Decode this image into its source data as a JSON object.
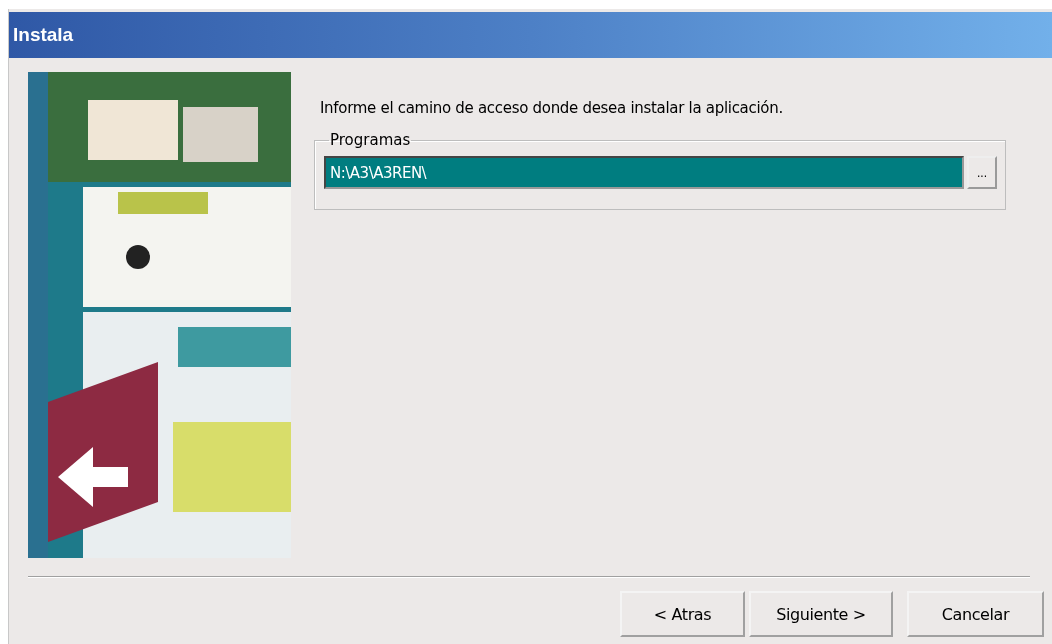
{
  "window": {
    "title": "Instala"
  },
  "instruction": "Informe el camino de acceso donde desea instalar la aplicación.",
  "group": {
    "label": "Programas",
    "path_field": {
      "value": "N:\\A3\\A3REN\\",
      "selected": true
    },
    "browse_button": "..."
  },
  "buttons": [
    {
      "label": "< Atras"
    },
    {
      "label": "Siguiente >"
    },
    {
      "label": "Cancelar"
    }
  ]
}
